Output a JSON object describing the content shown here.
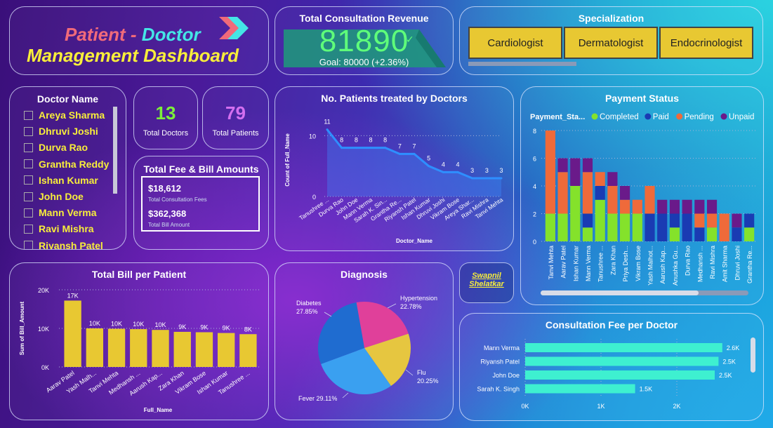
{
  "title": {
    "line1_a": "Patient",
    "line1_sep": " - ",
    "line1_b": "Doctor",
    "line2": "Management Dashboard"
  },
  "revenue": {
    "title": "Total Consultation Revenue",
    "value": "81890",
    "goal": "Goal: 80000 (+2.36%)",
    "progress": 1.0236
  },
  "specialization": {
    "title": "Specialization",
    "items": [
      "Cardiologist",
      "Dermatologist",
      "Endocrinologist"
    ]
  },
  "doctor_filter": {
    "title": "Doctor Name",
    "items": [
      "Areya Sharma",
      "Dhruvi Joshi",
      "Durva Rao",
      "Grantha Reddy",
      "Ishan Kumar",
      "John Doe",
      "Mann Verma",
      "Ravi Mishra",
      "Riyansh Patel"
    ]
  },
  "kpis": {
    "total_doctors": "13",
    "total_doctors_label": "Total Doctors",
    "total_patients": "79",
    "total_patients_label": "Total Patients"
  },
  "fees": {
    "title": "Total Fee & Bill Amounts",
    "consult_value": "$18,612",
    "consult_label": "Total Consultation Fees",
    "bill_value": "$362,368",
    "bill_label": "Total Bill Amount"
  },
  "author": {
    "line1": "Swapnil",
    "line2": "Shelatkar"
  },
  "colors": {
    "yellow": "#e8c832",
    "line": "#2e8fff",
    "completed": "#84e22b",
    "paid": "#1a3bb3",
    "pending": "#ef6a3a",
    "unpaid": "#6a1a8a",
    "teal_bar": "#3ef0d0"
  },
  "chart_data": [
    {
      "id": "patients_by_doctor",
      "type": "area",
      "title": "No. Patients treated by Doctors",
      "xlabel": "Doctor_Name",
      "ylabel": "Count of Full_Name",
      "categories": [
        "Tanushree ...",
        "Durva Rao",
        "John Doe",
        "Mann Verma",
        "Sarah K. Sin...",
        "Grantha Re...",
        "Riyansh Patel",
        "Ishan Kumar",
        "Dhruvi Joshi",
        "Vikram Bose",
        "Areya Shar...",
        "Ravi Mishra",
        "Tanvi Mehta"
      ],
      "values": [
        11,
        8,
        8,
        8,
        8,
        7,
        7,
        5,
        4,
        4,
        3,
        3,
        3
      ],
      "yticks": [
        0,
        10
      ],
      "ylim": [
        0,
        12
      ]
    },
    {
      "id": "payment_status",
      "type": "bar",
      "stacked": true,
      "title": "Payment Status",
      "legend_title": "Payment_Sta...",
      "legend_position": "top-left",
      "series_names": [
        "Completed",
        "Paid",
        "Pending",
        "Unpaid"
      ],
      "categories": [
        "Tanvi Mehta",
        "Aarav Patel",
        "Ishan Kumar",
        "Mann Verma",
        "Tanushree ...",
        "Zara Khan",
        "Priya Desh...",
        "Vikram Bose",
        "Yash Malhot...",
        "Aarush Kap...",
        "Anushka Gu...",
        "Durva Rao",
        "Medhansh ...",
        "Ravi Mishra",
        "Amit Sharma",
        "Dhruvi Joshi",
        "Grantha Re..."
      ],
      "series": [
        {
          "name": "Completed",
          "values": [
            2,
            2,
            4,
            1,
            3,
            2,
            2,
            2,
            0,
            0,
            1,
            0,
            0,
            1,
            0,
            0,
            1
          ]
        },
        {
          "name": "Paid",
          "values": [
            0,
            0,
            0,
            1,
            1,
            0,
            0,
            0,
            2,
            2,
            1,
            2,
            1,
            0,
            0,
            1,
            1
          ]
        },
        {
          "name": "Pending",
          "values": [
            6,
            3,
            0,
            3,
            1,
            2,
            1,
            1,
            2,
            0,
            0,
            0,
            1,
            1,
            2,
            0,
            0
          ]
        },
        {
          "name": "Unpaid",
          "values": [
            0,
            1,
            2,
            1,
            0,
            1,
            1,
            0,
            0,
            1,
            1,
            1,
            1,
            1,
            0,
            1,
            0
          ]
        }
      ],
      "yticks": [
        0,
        2,
        4,
        6,
        8
      ],
      "ylim": [
        0,
        8
      ]
    },
    {
      "id": "bill_per_patient",
      "type": "bar",
      "title": "Total Bill per Patient",
      "xlabel": "Full_Name",
      "ylabel": "Sum of Bill_Amount",
      "categories": [
        "Aarav Patel",
        "Yash Malh...",
        "Tanvi Mehta",
        "Medhansh ...",
        "Aarush Kap...",
        "Zara Khan",
        "Vikram Bose",
        "Ishan Kumar",
        "Tanushree ..."
      ],
      "values": [
        17200,
        10000,
        9900,
        9800,
        9600,
        9100,
        9000,
        8800,
        8500
      ],
      "labels": [
        "17K",
        "10K",
        "10K",
        "10K",
        "10K",
        "9K",
        "9K",
        "9K",
        "8K"
      ],
      "yticks": [
        "0K",
        "10K",
        "20K"
      ],
      "ylim": [
        0,
        20000
      ]
    },
    {
      "id": "diagnosis",
      "type": "pie",
      "title": "Diagnosis",
      "slices": [
        {
          "label": "Hypertension",
          "pct": "22.78%",
          "value": 22.78,
          "color": "#e0409a"
        },
        {
          "label": "Flu",
          "pct": "20.25%",
          "value": 20.25,
          "color": "#e6c640"
        },
        {
          "label": "Fever",
          "pct": "29.11%",
          "value": 29.11,
          "color": "#3aa0f0"
        },
        {
          "label": "Diabetes",
          "pct": "27.85%",
          "value": 27.85,
          "color": "#1f6cd0"
        }
      ]
    },
    {
      "id": "consult_fee_per_doctor",
      "type": "bar",
      "orientation": "horizontal",
      "title": "Consultation Fee per Doctor",
      "categories": [
        "Mann Verma",
        "Riyansh Patel",
        "John Doe",
        "Sarah K. Singh"
      ],
      "values": [
        2600,
        2550,
        2500,
        1450
      ],
      "labels": [
        "2.6K",
        "2.5K",
        "2.5K",
        "1.5K"
      ],
      "xticks": [
        "0K",
        "1K",
        "2K"
      ],
      "xlim": [
        0,
        3000
      ]
    }
  ]
}
